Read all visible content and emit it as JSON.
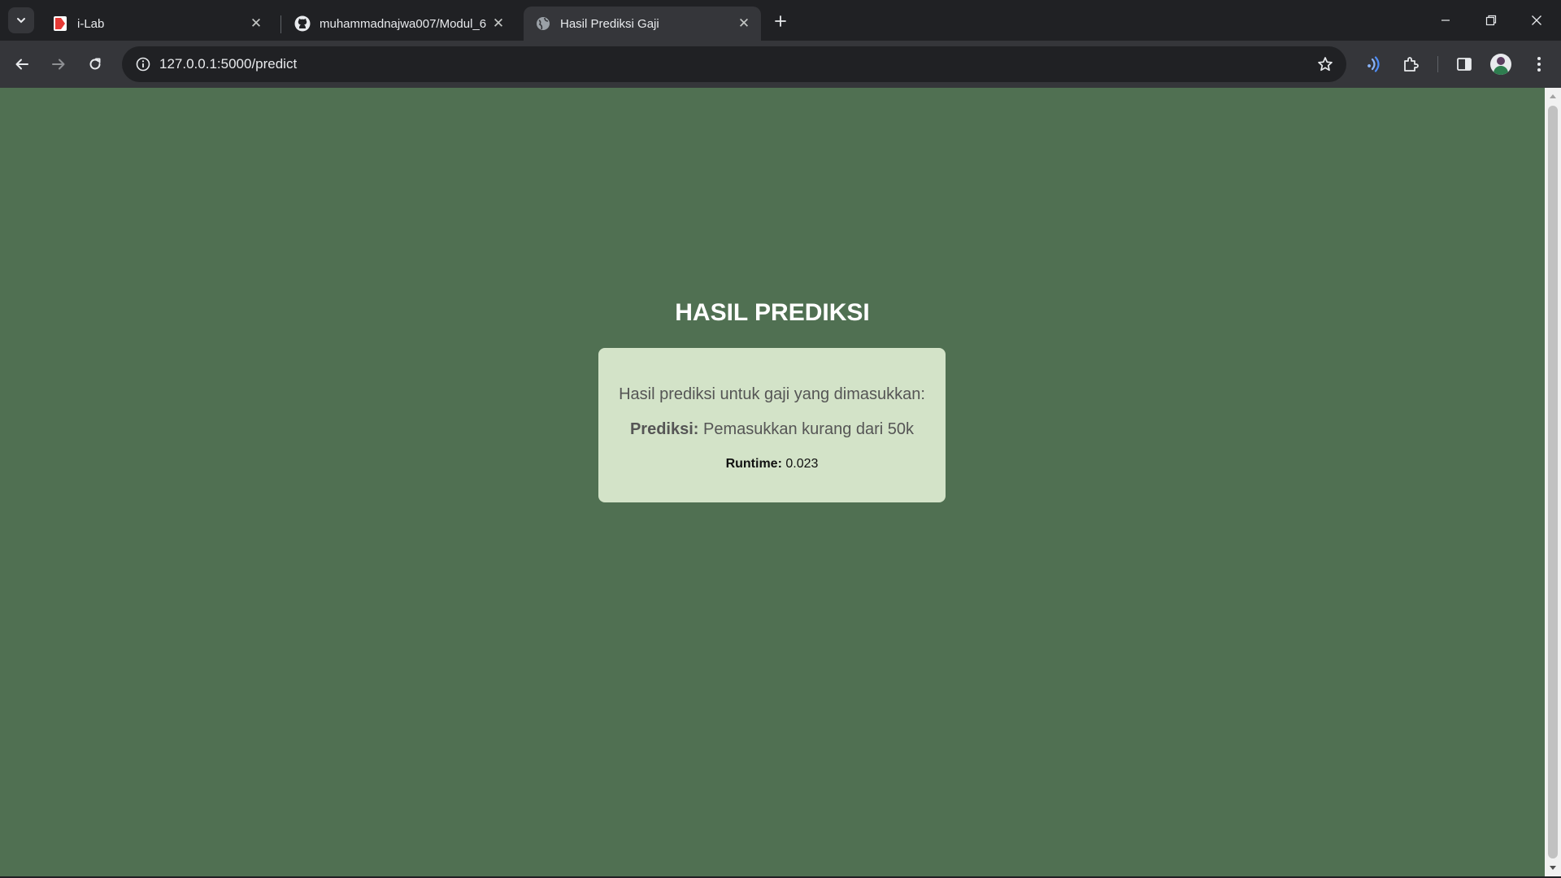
{
  "browser": {
    "tabs": [
      {
        "title": "i-Lab",
        "active": false,
        "favicon": "ilab-favicon"
      },
      {
        "title": "muhammadnajwa007/Modul_6",
        "active": false,
        "favicon": "github-icon"
      },
      {
        "title": "Hasil Prediksi Gaji",
        "active": true,
        "favicon": "globe-icon"
      }
    ],
    "address": "127.0.0.1:5000/predict",
    "colors": {
      "frame": "#202124",
      "toolbar": "#35363a",
      "accent_icon": "#8ab4f8"
    }
  },
  "page": {
    "title": "HASIL PREDIKSI",
    "intro": "Hasil prediksi untuk gaji yang dimasukkan:",
    "prediction_label": "Prediksi:",
    "prediction_value": "Pemasukkan kurang dari 50k",
    "runtime_label": "Runtime:",
    "runtime_value": "0.023",
    "colors": {
      "background": "#507052",
      "card": "#d3e3c8",
      "text": "#555555"
    }
  }
}
